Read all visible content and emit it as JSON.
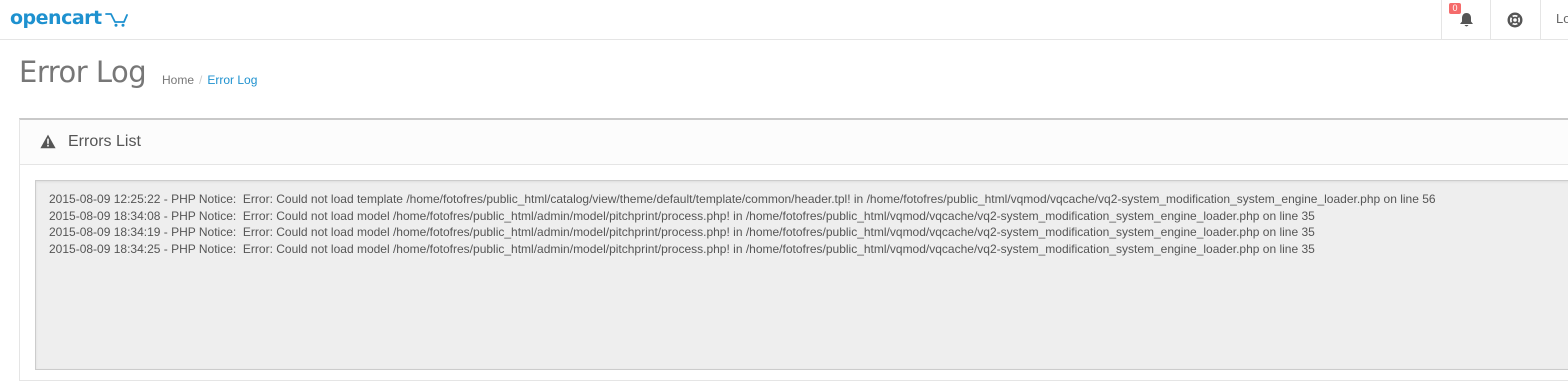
{
  "header": {
    "logo_text": "opencart",
    "notification_count": "0",
    "logout_label": "Lo"
  },
  "page": {
    "title": "Error Log",
    "breadcrumb": [
      {
        "label": "Home"
      },
      {
        "label": "Error Log"
      }
    ]
  },
  "panel": {
    "title": "Errors List"
  },
  "log": {
    "lines": [
      "2015-08-09 12:25:22 - PHP Notice:  Error: Could not load template /home/fotofres/public_html/catalog/view/theme/default/template/common/header.tpl! in /home/fotofres/public_html/vqmod/vqcache/vq2-system_modification_system_engine_loader.php on line 56",
      "2015-08-09 18:34:08 - PHP Notice:  Error: Could not load model /home/fotofres/public_html/admin/model/pitchprint/process.php! in /home/fotofres/public_html/vqmod/vqcache/vq2-system_modification_system_engine_loader.php on line 35",
      "2015-08-09 18:34:19 - PHP Notice:  Error: Could not load model /home/fotofres/public_html/admin/model/pitchprint/process.php! in /home/fotofres/public_html/vqmod/vqcache/vq2-system_modification_system_engine_loader.php on line 35",
      "2015-08-09 18:34:25 - PHP Notice:  Error: Could not load model /home/fotofres/public_html/admin/model/pitchprint/process.php! in /home/fotofres/public_html/vqmod/vqcache/vq2-system_modification_system_engine_loader.php on line 35"
    ]
  },
  "colors": {
    "brand": "#1e91cf",
    "badge": "#f56b6b",
    "log_background": "#eeeeee"
  },
  "icons": {
    "logo": "cart-icon",
    "notifications": "bell-icon",
    "help": "life-ring-icon",
    "panel": "warning-icon"
  }
}
